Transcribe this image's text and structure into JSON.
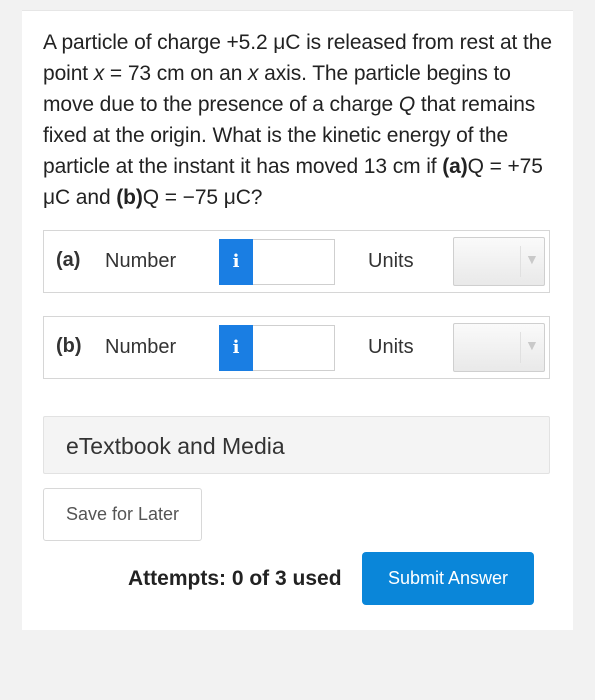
{
  "question": {
    "s1": "A particle of charge +5.2 μC is released from rest at the point ",
    "x_var": "x",
    "s2": " = 73 cm on an ",
    "x_var2": "x",
    "s3": " axis. The particle begins to move due to the presence of a charge ",
    "q_var": "Q",
    "s4": " that remains fixed at the origin. What is the kinetic energy of the particle at the instant it has moved 13 cm if ",
    "part_a": "(a)",
    "s5": "Q = +75 μC and ",
    "part_b": "(b)",
    "s6": "Q = −75 μC?"
  },
  "rows": [
    {
      "part": "(a)",
      "number_label": "Number",
      "info_icon": "i",
      "number_value": "",
      "units_label": "Units",
      "units_value": ""
    },
    {
      "part": "(b)",
      "number_label": "Number",
      "info_icon": "i",
      "number_value": "",
      "units_label": "Units",
      "units_value": ""
    }
  ],
  "etextbook_label": "eTextbook and Media",
  "save_label": "Save for Later",
  "attempts_label": "Attempts: 0 of 3 used",
  "submit_label": "Submit Answer",
  "colors": {
    "info_button": "#1a7ee3",
    "submit_button": "#0a86d9"
  }
}
